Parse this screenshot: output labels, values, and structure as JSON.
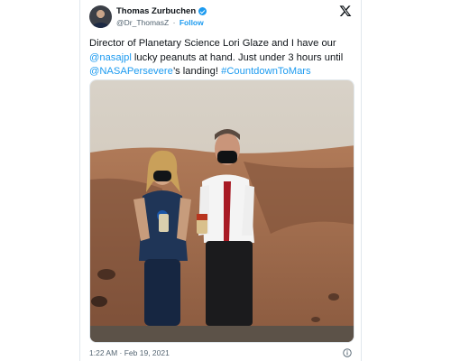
{
  "author": {
    "name": "Thomas Zurbuchen",
    "handle": "@Dr_ThomasZ",
    "separator": "·",
    "follow_label": "Follow"
  },
  "tweet": {
    "text_1": "Director of Planetary Science Lori Glaze and I have our ",
    "mention_1": "@nasajpl",
    "text_2": " lucky peanuts at hand. Just under 3 hours until ",
    "mention_2": "@NASAPersevere",
    "text_3": "’s landing! ",
    "hashtag": "#CountdownToMars"
  },
  "footer": {
    "timestamp": "1:22 AM · Feb 19, 2021"
  },
  "icons": {
    "platform_logo": "x-logo-icon",
    "verified": "verified-badge-icon",
    "info": "info-icon"
  },
  "colors": {
    "link": "#1d9bf0",
    "text": "#0f1419",
    "muted": "#536471"
  }
}
